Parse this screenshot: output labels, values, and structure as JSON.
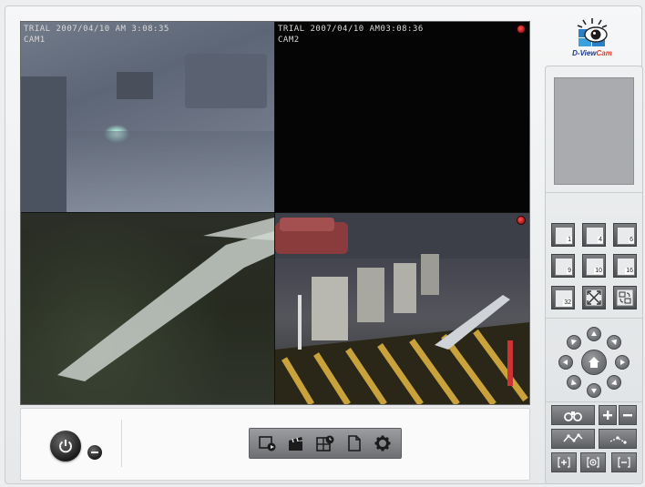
{
  "cameras": [
    {
      "id": "cam1",
      "osd_line1": "TRIAL 2007/04/10 AM 3:08:35",
      "osd_line2": "CAM1"
    },
    {
      "id": "cam2",
      "osd_line1": "TRIAL 2007/04/10 AM03:08:36",
      "osd_line2": "CAM2"
    },
    {
      "id": "cam3",
      "osd_line1": "",
      "osd_line2": ""
    },
    {
      "id": "cam4",
      "osd_line1": "",
      "osd_line2": ""
    }
  ],
  "logo": {
    "brand_part1": "D-View",
    "brand_part2": "Cam"
  },
  "split_buttons": [
    {
      "label": "1"
    },
    {
      "label": "4"
    },
    {
      "label": "6"
    },
    {
      "label": "9"
    },
    {
      "label": "10"
    },
    {
      "label": "16"
    },
    {
      "label": "32"
    },
    {
      "label": ""
    },
    {
      "label": ""
    }
  ],
  "colors": {
    "rec_indicator": "#d21f1f",
    "brand_blue": "#1a3a8a",
    "brand_red": "#e03a2a",
    "toolbar_bg": "#6d6f73"
  },
  "icons": {
    "power": "power-icon",
    "minimize": "minimize-icon",
    "toolbar": [
      "playback-icon",
      "record-clapper-icon",
      "schedule-grid-icon",
      "document-icon",
      "settings-gear-icon"
    ],
    "ptz": [
      "up-arrow-icon",
      "down-arrow-icon",
      "left-arrow-icon",
      "right-arrow-icon",
      "home-icon"
    ],
    "camera_controls": [
      "binoculars-icon",
      "zoom-plus-icon",
      "zoom-minus-icon",
      "pattern-icon",
      "preset-icon",
      "focus-near-icon",
      "focus-center-icon",
      "focus-far-icon"
    ]
  }
}
